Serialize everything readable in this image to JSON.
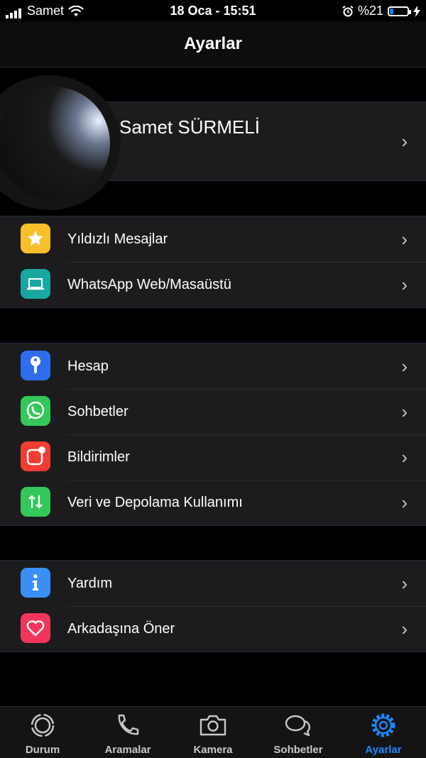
{
  "status_bar": {
    "carrier": "Samet",
    "datetime": "18 Oca - 15:51",
    "battery_text": "%21",
    "battery_level": 0.21
  },
  "nav": {
    "title": "Ayarlar"
  },
  "profile": {
    "name": "Samet SÜRMELİ"
  },
  "groups": [
    {
      "items": [
        {
          "label": "Yıldızlı Mesajlar",
          "icon": "star-icon",
          "color": "#f7c02b"
        },
        {
          "label": "WhatsApp Web/Masaüstü",
          "icon": "laptop-icon",
          "color": "#1aa7a1"
        }
      ]
    },
    {
      "items": [
        {
          "label": "Hesap",
          "icon": "key-icon",
          "color": "#2f6df0"
        },
        {
          "label": "Sohbetler",
          "icon": "whatsapp-icon",
          "color": "#34c759"
        },
        {
          "label": "Bildirimler",
          "icon": "notification-icon",
          "color": "#f23d32"
        },
        {
          "label": "Veri ve Depolama Kullanımı",
          "icon": "data-arrows-icon",
          "color": "#34c759"
        }
      ]
    },
    {
      "items": [
        {
          "label": "Yardım",
          "icon": "info-icon",
          "color": "#3a8ff7"
        },
        {
          "label": "Arkadaşına Öner",
          "icon": "heart-icon",
          "color": "#f2365b"
        }
      ]
    }
  ],
  "tabs": [
    {
      "label": "Durum",
      "icon": "status-icon",
      "active": false
    },
    {
      "label": "Aramalar",
      "icon": "phone-icon",
      "active": false
    },
    {
      "label": "Kamera",
      "icon": "camera-icon",
      "active": false
    },
    {
      "label": "Sohbetler",
      "icon": "chats-icon",
      "active": false
    },
    {
      "label": "Ayarlar",
      "icon": "settings-gear-icon",
      "active": true
    }
  ],
  "colors": {
    "accent": "#1a88ff",
    "background": "#000000",
    "cell": "#1c1c1e"
  }
}
